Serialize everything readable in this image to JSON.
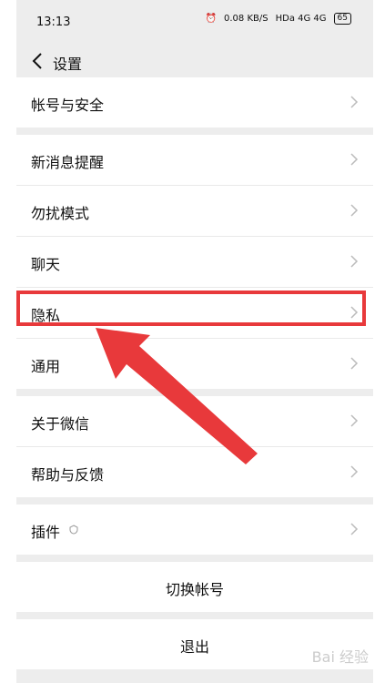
{
  "status": {
    "time": "13:13",
    "speed": "0.08 KB/S",
    "network": "HDa 4G 4G",
    "battery": "65"
  },
  "header": {
    "title": "设置"
  },
  "sections": [
    {
      "items": [
        {
          "label": "帐号与安全"
        }
      ]
    },
    {
      "items": [
        {
          "label": "新消息提醒"
        },
        {
          "label": "勿扰模式"
        },
        {
          "label": "聊天"
        },
        {
          "label": "隐私"
        },
        {
          "label": "通用"
        }
      ]
    },
    {
      "items": [
        {
          "label": "关于微信"
        },
        {
          "label": "帮助与反馈"
        }
      ]
    },
    {
      "items": [
        {
          "label": "插件"
        }
      ]
    }
  ],
  "actions": {
    "switch_account": "切换帐号",
    "logout": "退出"
  },
  "watermark": "Bai 经验",
  "colors": {
    "highlight": "#e8393b",
    "background": "#ededed"
  }
}
